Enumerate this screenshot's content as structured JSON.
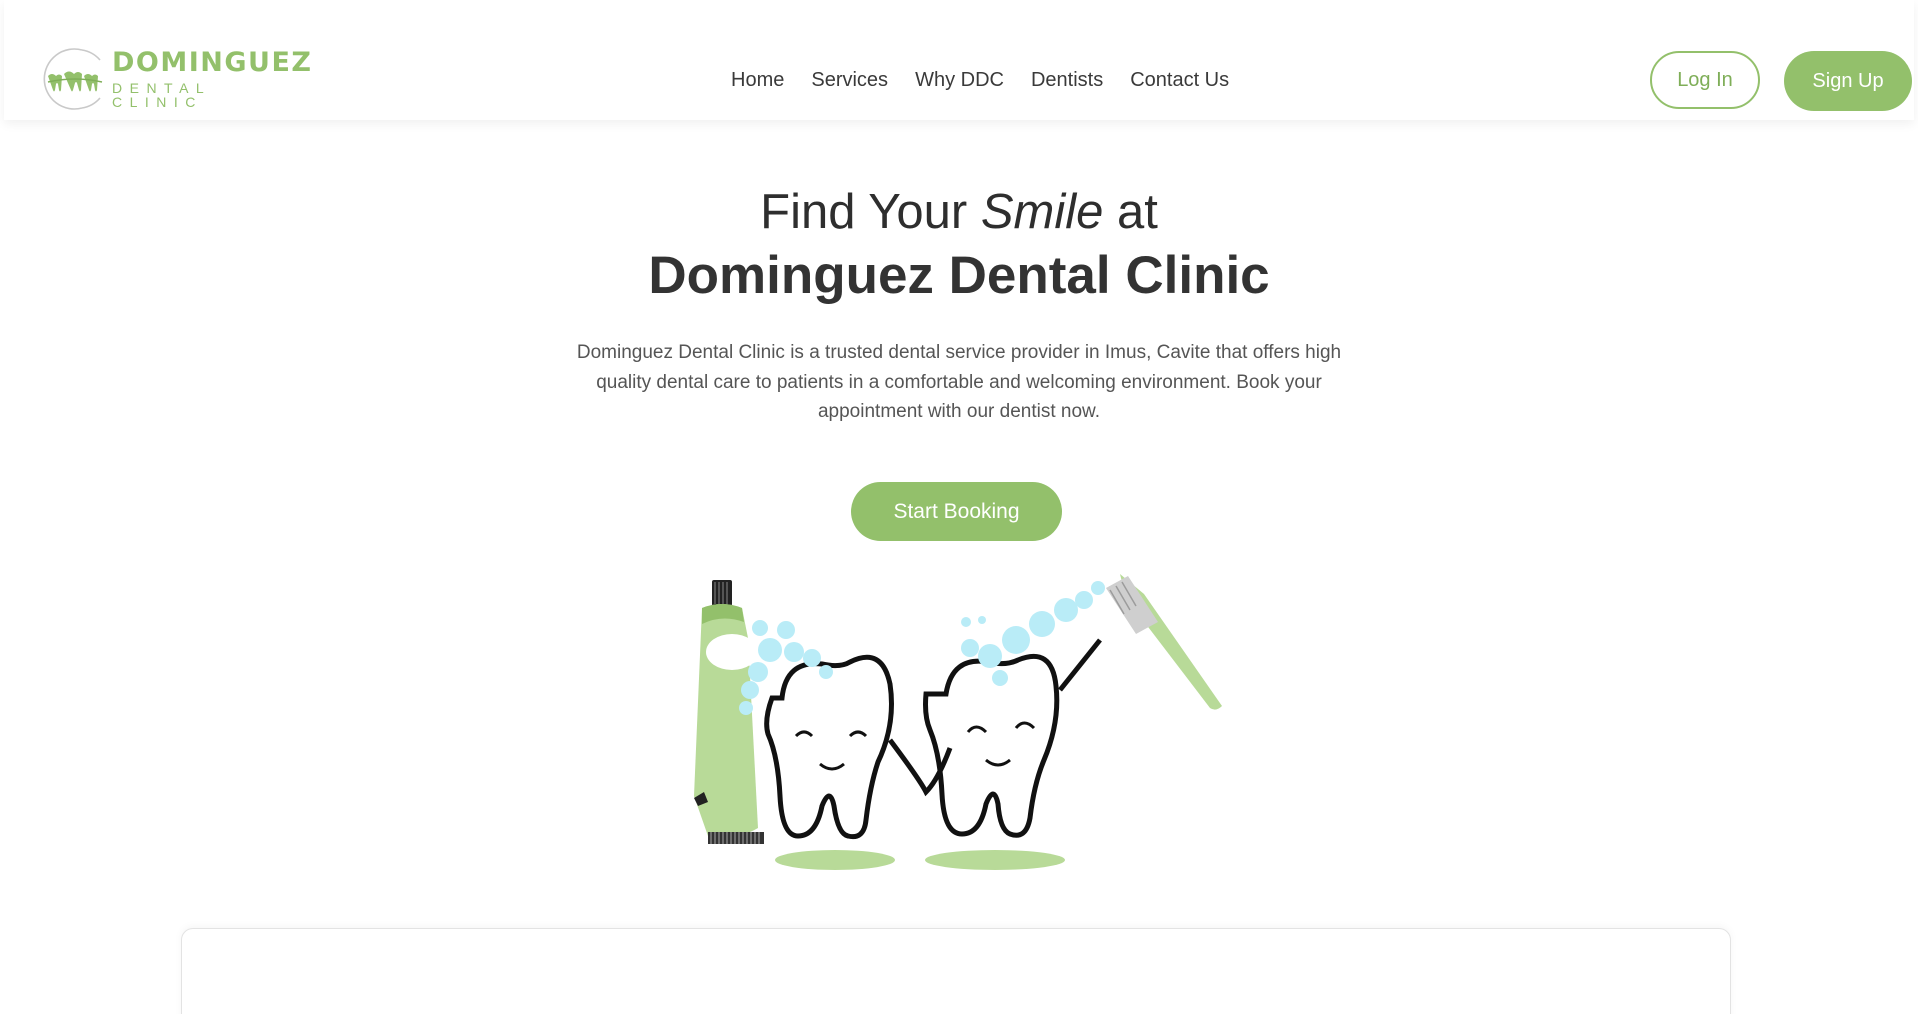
{
  "brand": {
    "name": "DOMINGUEZ",
    "sub": "DENTAL CLINIC",
    "logo_icon": "teeth-logo-icon"
  },
  "nav": {
    "items": [
      {
        "label": "Home"
      },
      {
        "label": "Services"
      },
      {
        "label": "Why DDC"
      },
      {
        "label": "Dentists"
      },
      {
        "label": "Contact Us"
      }
    ]
  },
  "auth": {
    "login_label": "Log In",
    "signup_label": "Sign Up"
  },
  "hero": {
    "title_prefix": "Find Your ",
    "title_emphasis": "Smile",
    "title_suffix": " at",
    "title_line2": "Dominguez Dental Clinic",
    "description": "Dominguez Dental Clinic is a trusted dental service provider in Imus, Cavite that offers high quality dental care to patients in a comfortable and welcoming environment. Book your appointment with our dentist now.",
    "cta_label": "Start Booking",
    "illustration": "smiling-teeth-toothpaste-toothbrush-illustration"
  },
  "colors": {
    "accent": "#93c06b",
    "text": "#2e2e2e",
    "muted_text": "#555555",
    "bubbles": "#b9ecf7"
  }
}
